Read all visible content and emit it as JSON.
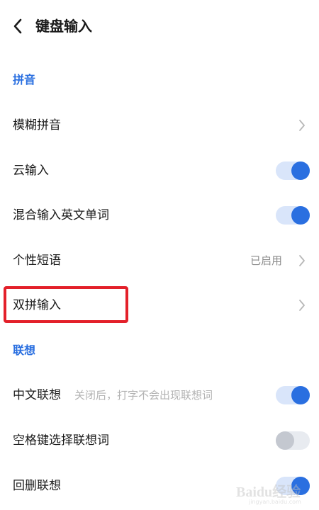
{
  "header": {
    "title": "键盘输入",
    "back_icon": "chevron-left-icon"
  },
  "sections": {
    "pinyin": {
      "title": "拼音"
    },
    "association": {
      "title": "联想"
    }
  },
  "rows": {
    "fuzzy": {
      "label": "模糊拼音",
      "trailing": "chevron"
    },
    "cloud": {
      "label": "云输入",
      "toggle": true
    },
    "mixed": {
      "label": "混合输入英文单词",
      "toggle": true
    },
    "phrases": {
      "label": "个性短语",
      "value": "已启用",
      "trailing": "chevron"
    },
    "double": {
      "label": "双拼输入",
      "trailing": "chevron",
      "highlighted": true
    },
    "chinese_assoc": {
      "label": "中文联想",
      "hint": "关闭后，打字不会出现联想词",
      "toggle": true
    },
    "space_assoc": {
      "label": "空格键选择联想词",
      "toggle": false
    },
    "backspace_assoc": {
      "label": "回删联想",
      "toggle": true
    }
  },
  "watermark": {
    "text": "Baidu经验",
    "sub": "jingyan.baidu.com"
  },
  "colors": {
    "accent": "#2a6fe0",
    "highlight": "#e3202a",
    "toggle_on_track": "#d9e5fa",
    "toggle_off_track": "#e8ebf0"
  }
}
